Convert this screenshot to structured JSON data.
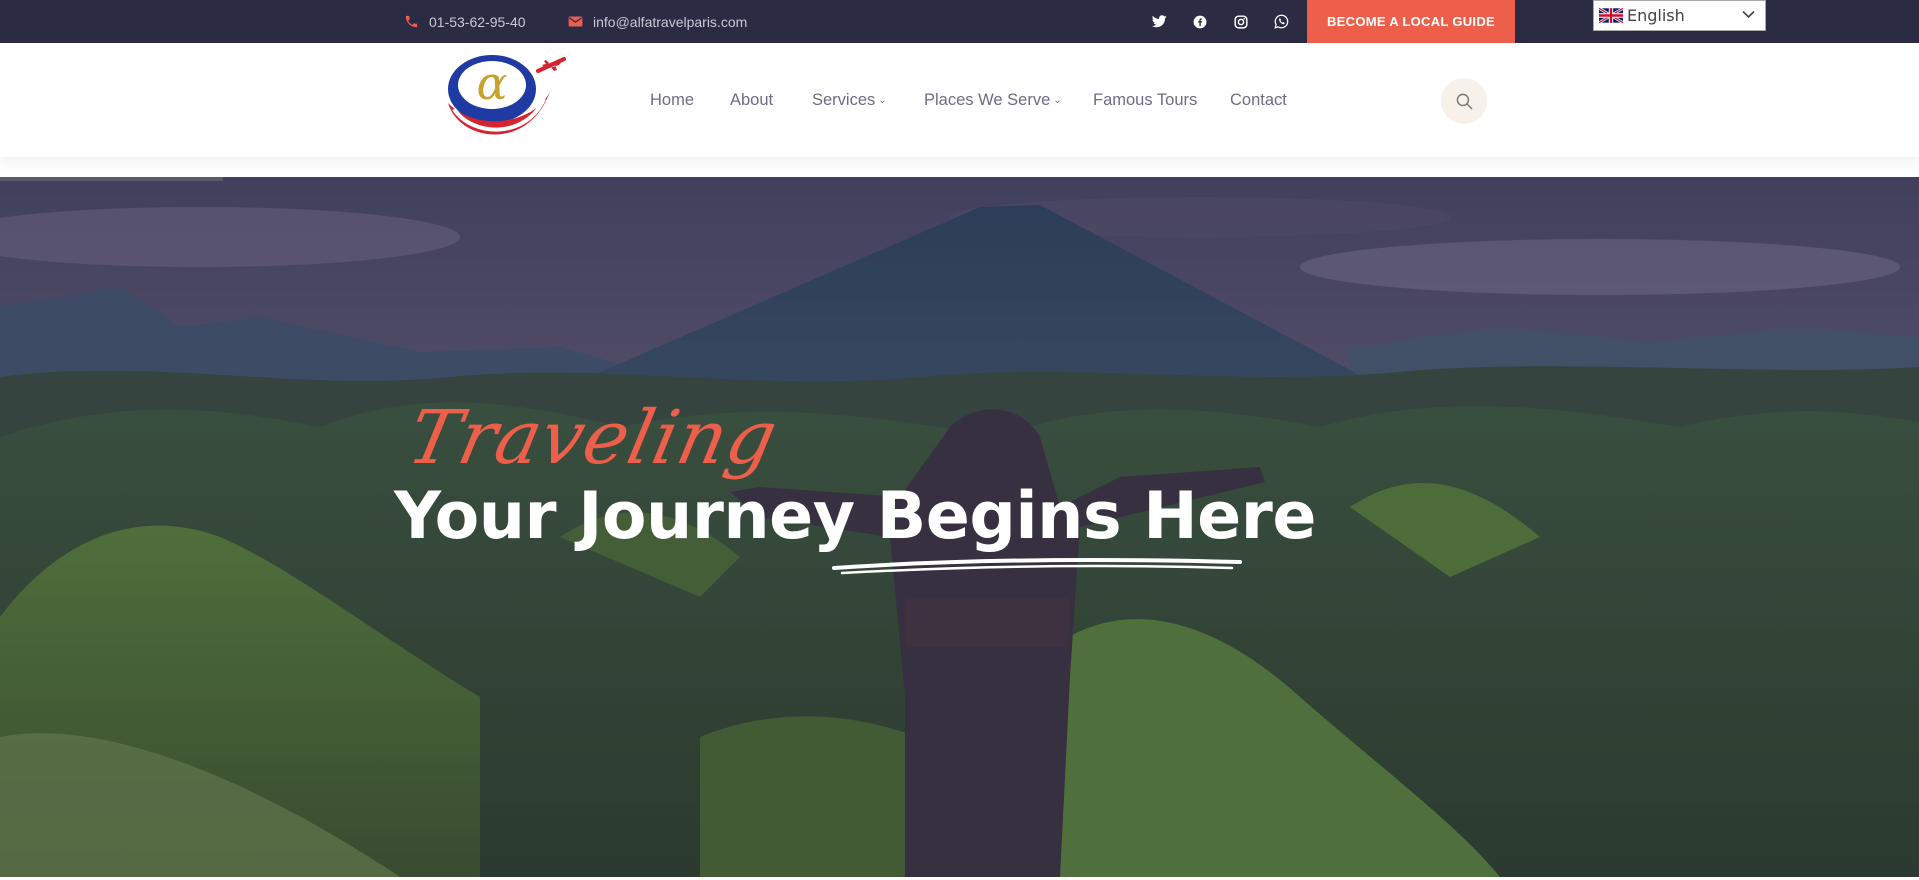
{
  "topbar": {
    "phone": "01-53-62-95-40",
    "email": "info@alfatravelparis.com",
    "social_icons": [
      "twitter-icon",
      "facebook-icon",
      "instagram-icon",
      "whatsapp-icon"
    ],
    "cta_label": "BECOME A LOCAL GUIDE",
    "language": "English"
  },
  "nav": {
    "items": [
      {
        "label": "Home"
      },
      {
        "label": "About"
      },
      {
        "label": "Services"
      },
      {
        "label": "Places We Serve"
      },
      {
        "label": "Famous Tours"
      },
      {
        "label": "Contact"
      }
    ]
  },
  "hero": {
    "tagline": "Traveling",
    "headline": "Your Journey Begins Here"
  },
  "colors": {
    "topbar_bg": "#2c2b44",
    "accent": "#ee5f4b",
    "nav_text": "#6e6d85",
    "search_bg": "#f7f1ea"
  }
}
